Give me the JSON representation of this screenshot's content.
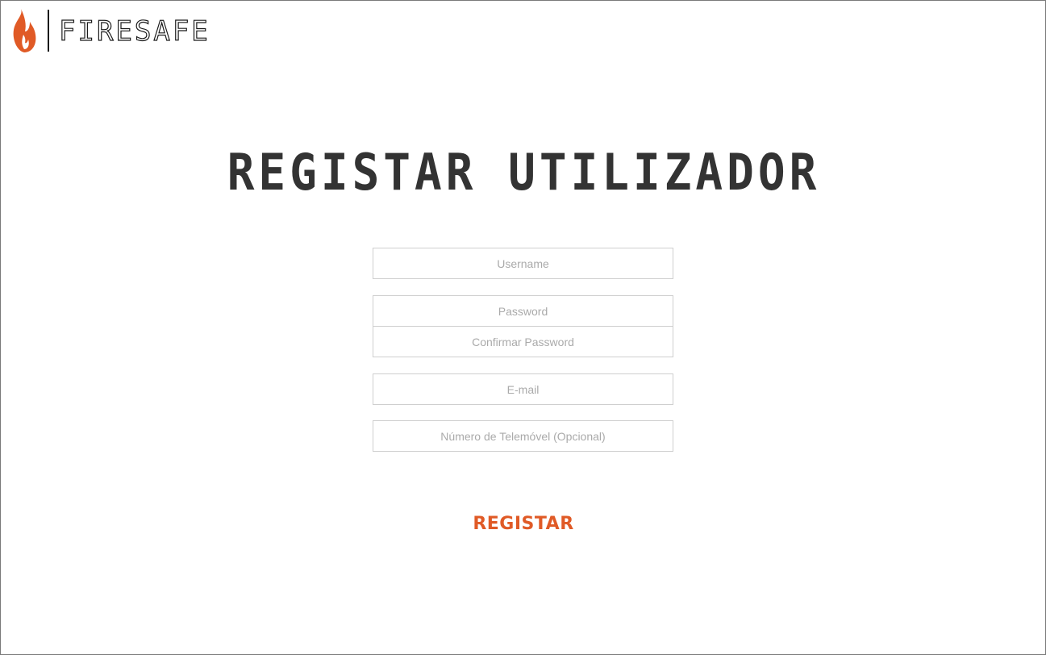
{
  "brand": {
    "logo_text": "FIRESAFE",
    "icon": "flame-icon",
    "accent_color": "#e05a26"
  },
  "page": {
    "title": "REGISTAR UTILIZADOR"
  },
  "form": {
    "username_placeholder": "Username",
    "password_placeholder": "Password",
    "confirm_password_placeholder": "Confirmar Password",
    "email_placeholder": "E-mail",
    "phone_placeholder": "Número de Telemóvel (Opcional)",
    "username_value": "",
    "password_value": "",
    "confirm_password_value": "",
    "email_value": "",
    "phone_value": "",
    "submit_label": "REGISTAR"
  }
}
